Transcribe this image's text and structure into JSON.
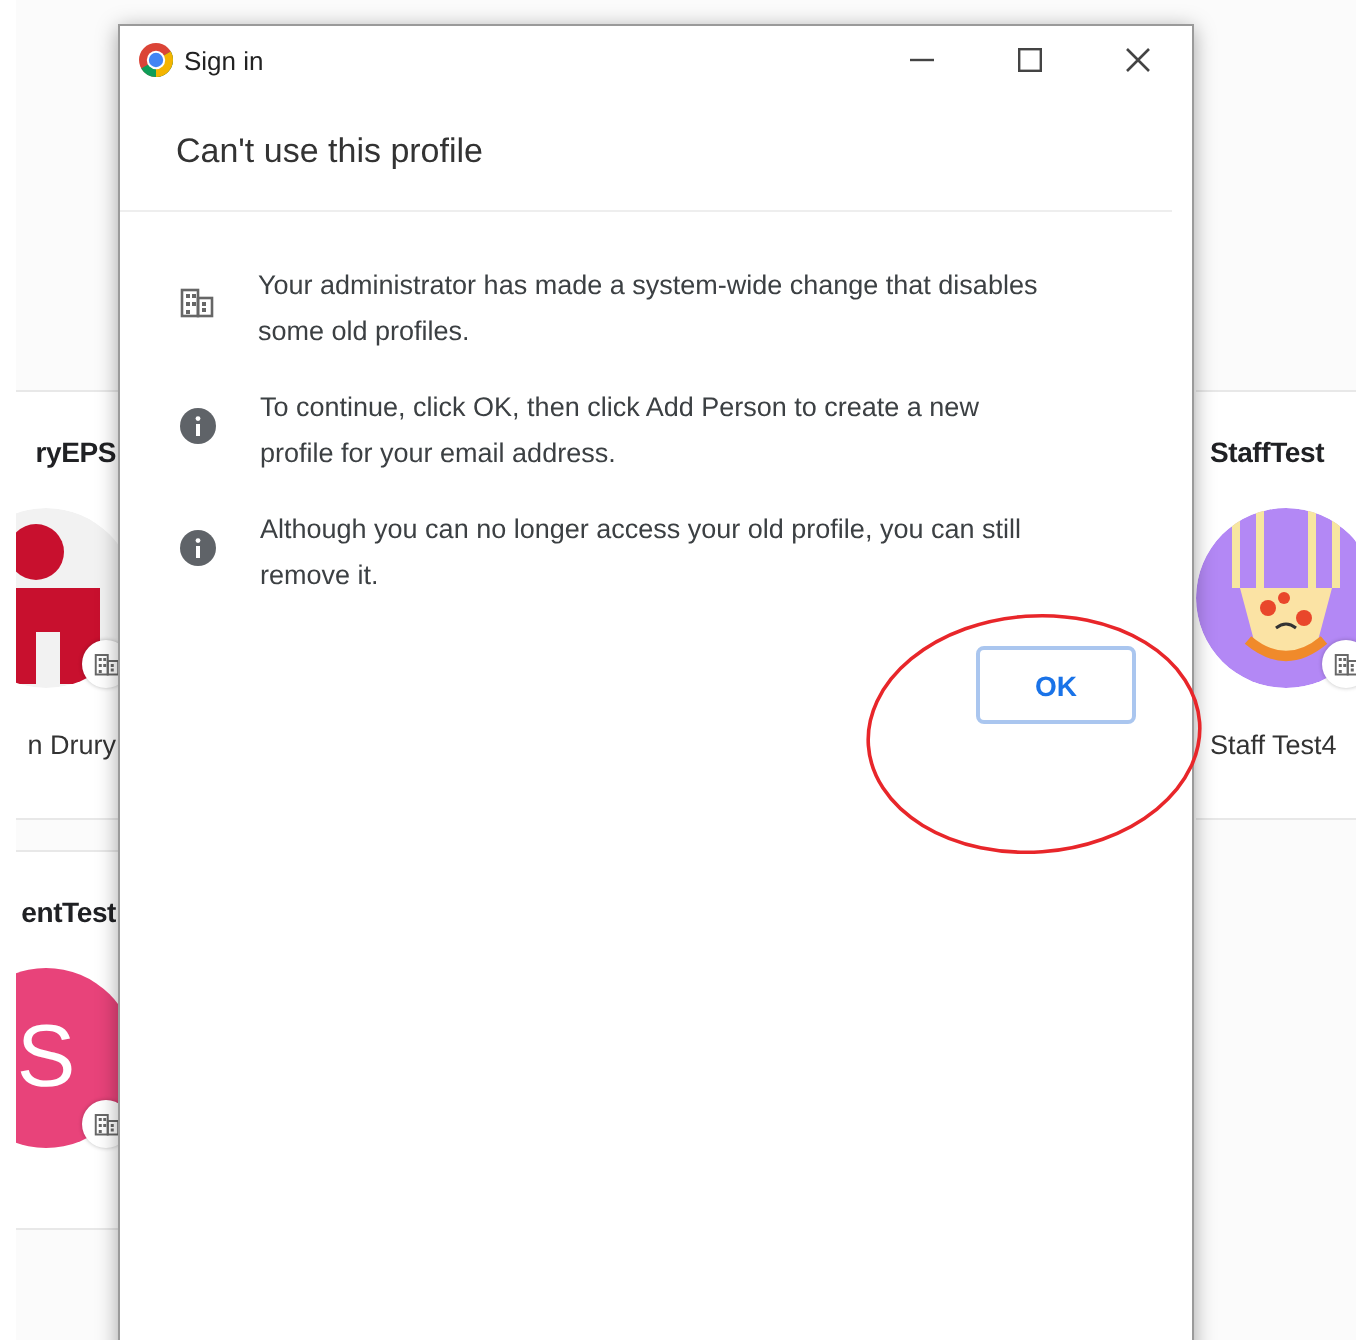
{
  "background_profiles": [
    {
      "name": "ryEPS",
      "caption": "n Drury",
      "avatar": {
        "kind": "figure",
        "color": "#c8102e"
      }
    },
    {
      "name": "entTest",
      "avatar": {
        "kind": "letter",
        "letter": "S",
        "color": "#e8437a"
      }
    },
    {
      "name": "StaffTest",
      "caption": "Staff Test4",
      "avatar": {
        "kind": "pizza",
        "color": "#b388f5"
      }
    }
  ],
  "window": {
    "title": "Sign in",
    "heading": "Can't use this profile"
  },
  "messages": [
    {
      "kind": "building",
      "text": "Your administrator has made a system-wide change that disables some old profiles."
    },
    {
      "kind": "info",
      "text": "To continue, click OK, then click Add Person to create a new profile for your email address."
    },
    {
      "kind": "info",
      "text": "Although you can no longer access your old profile, you can still remove it."
    }
  ],
  "ok_button": {
    "label": "OK"
  }
}
